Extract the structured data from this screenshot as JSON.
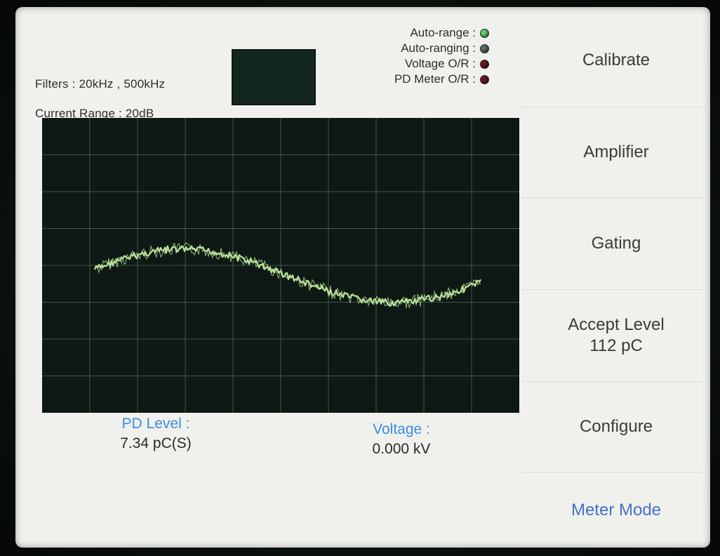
{
  "header": {
    "filters": "Filters : 20kHz , 500kHz",
    "current_range": "Current Range : 20dB"
  },
  "indicators": [
    {
      "label": "Auto-range :",
      "color": "#5fd06a"
    },
    {
      "label": "Auto-ranging :",
      "color": "#5d6e62"
    },
    {
      "label": "Voltage O/R :",
      "color": "#6a1a1e"
    },
    {
      "label": "PD Meter O/R :",
      "color": "#6a1a1e"
    }
  ],
  "readouts": {
    "pd_level_label": "PD Level :",
    "pd_level_value": "7.34 pC(S)",
    "voltage_label": "Voltage :",
    "voltage_value": "0.000 kV"
  },
  "menu": {
    "calibrate": "Calibrate",
    "amplifier": "Amplifier",
    "gating": "Gating",
    "accept_level_line1": "Accept Level",
    "accept_level_line2": "112 pC",
    "configure": "Configure",
    "meter_mode": "Meter Mode"
  },
  "trace": {
    "color": "#b9e39a",
    "grid_color": "#3f5a4c",
    "grid_columns": 10,
    "grid_rows": 8
  }
}
